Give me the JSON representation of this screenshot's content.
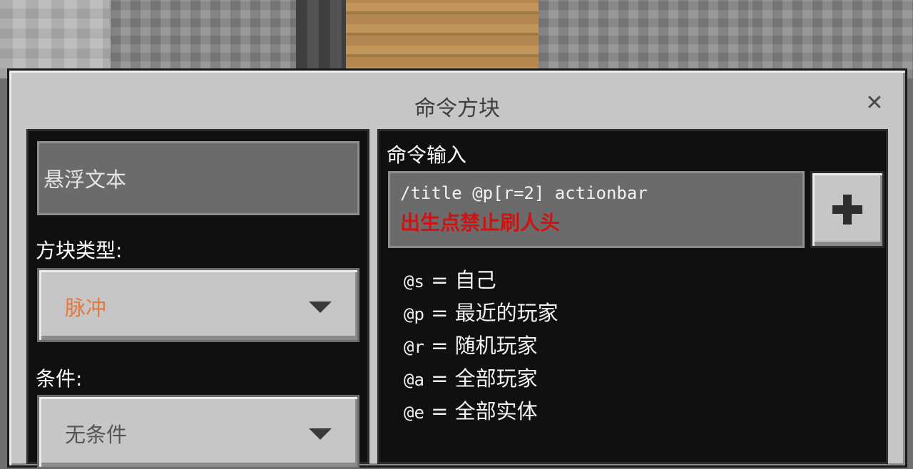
{
  "dialog": {
    "title": "命令方块",
    "close_icon": "close-icon"
  },
  "left": {
    "hover_text": "悬浮文本",
    "block_type_label": "方块类型:",
    "block_type_value": "脉冲",
    "block_type_color": "#e07a3e",
    "condition_label": "条件:",
    "condition_value": "无条件",
    "condition_color": "#555555"
  },
  "right": {
    "command_label": "命令输入",
    "command_line1": "/title @p[r=2] actionbar",
    "command_line2": "出生点禁止刷人头",
    "command_line2_color": "#d01212",
    "add_button_icon": "plus-icon",
    "help": [
      {
        "selector": "@s",
        "eq": "=",
        "desc": "自己"
      },
      {
        "selector": "@p",
        "eq": "=",
        "desc": "最近的玩家"
      },
      {
        "selector": "@r",
        "eq": "=",
        "desc": "随机玩家"
      },
      {
        "selector": "@a",
        "eq": "=",
        "desc": "全部玩家"
      },
      {
        "selector": "@e",
        "eq": "=",
        "desc": "全部实体"
      }
    ]
  }
}
